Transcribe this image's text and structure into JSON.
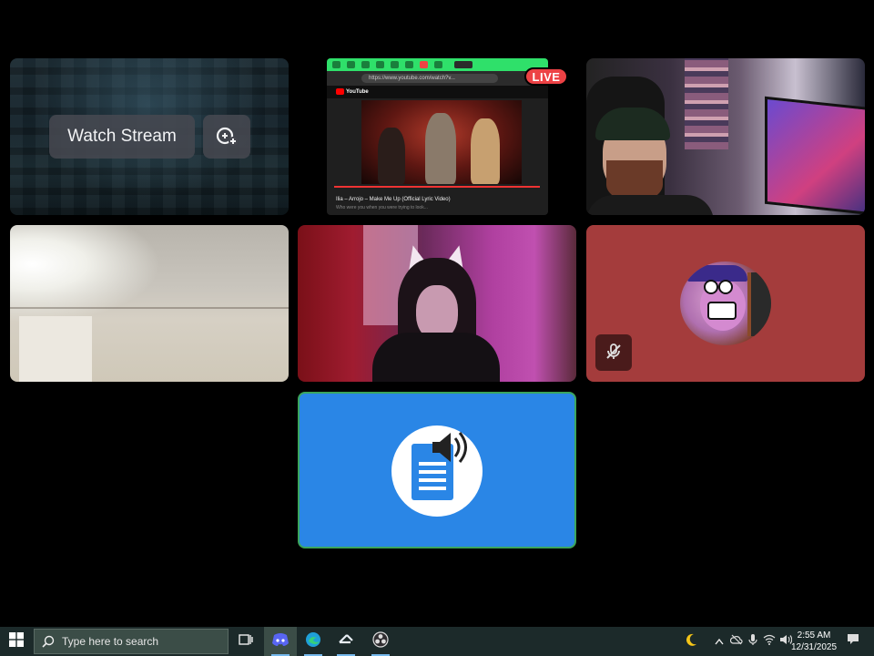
{
  "stream_tile": {
    "watch_label": "Watch Stream",
    "popout_icon": "popout-plus-icon"
  },
  "live_tile": {
    "badge": "LIVE",
    "browser_url": "https://www.youtube.com/watch?v...",
    "yt_logo": "YouTube",
    "video_title": "Ilia – Arrojo – Make Me Up (Official Lyric Video)",
    "video_sub": "Who were you when you were trying to look..."
  },
  "avatar_tile": {
    "mute_icon": "muted-mic-icon",
    "bg_color": "#a43c3c"
  },
  "tts_tile": {
    "icon": "document-speaker-icon",
    "bg_color": "#2a86e6"
  },
  "taskbar": {
    "search_placeholder": "Type here to search",
    "clock_time": "2:55 AM",
    "clock_date": "12/31/2025",
    "apps": [
      "task-view-icon",
      "discord-icon",
      "edge-icon",
      "steam-icon",
      "obs-icon"
    ]
  }
}
